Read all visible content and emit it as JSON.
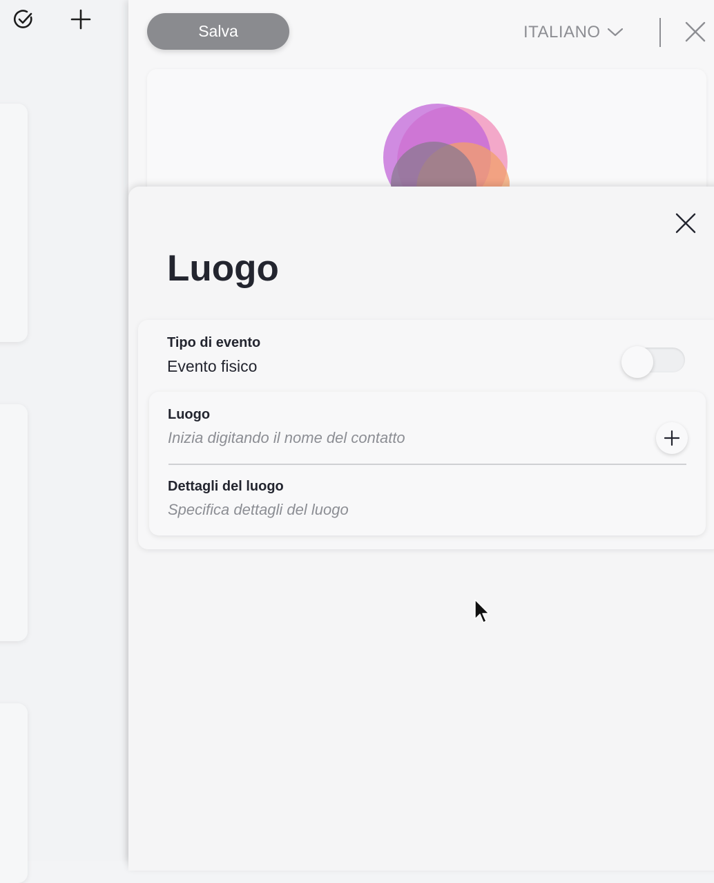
{
  "toolbar": {
    "save_label": "Salva",
    "language": "ITALIANO"
  },
  "sheet": {
    "title": "Luogo",
    "event_type": {
      "label": "Tipo di evento",
      "value": "Evento fisico",
      "toggle_on": false
    },
    "location": {
      "label": "Luogo",
      "placeholder": "Inizia digitando il nome del contatto"
    },
    "details": {
      "label": "Dettagli del luogo",
      "placeholder": "Specifica dettagli del luogo"
    }
  },
  "icons": {
    "top_left": [
      "check-circle-icon",
      "plus-icon"
    ],
    "close": "close-icon",
    "chevron": "chevron-down-icon",
    "add": "plus-icon"
  },
  "colors": {
    "save_button": "#8a8b8f",
    "text_dark": "#23252f",
    "text_muted": "#8c8e94",
    "logo_pink": "#f29ac0",
    "logo_purple": "#c165d8",
    "logo_orange": "#f2a06a"
  }
}
